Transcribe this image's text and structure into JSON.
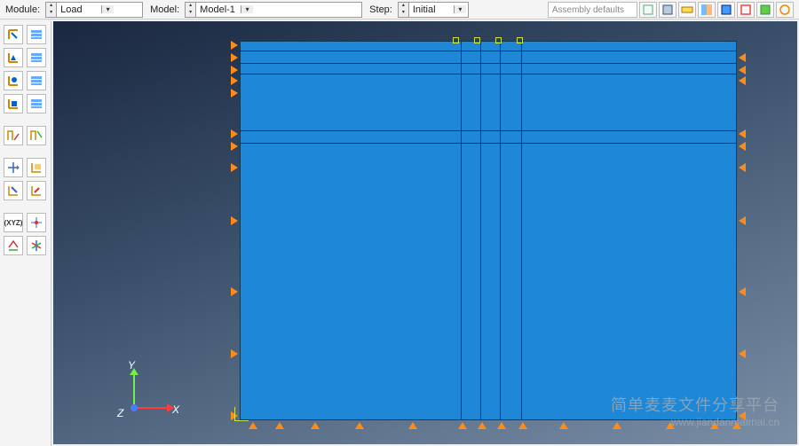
{
  "context_bar": {
    "module_label": "Module:",
    "module_value": "Load",
    "model_label": "Model:",
    "model_value": "Model-1",
    "step_label": "Step:",
    "step_value": "Initial"
  },
  "top_right": {
    "assembly_combo": "Assembly defaults"
  },
  "triad": {
    "x": "X",
    "y": "Y",
    "z": "Z"
  },
  "watermark": {
    "line1": "简单麦麦文件分享平台",
    "line2": "www.jiandanmaimai.cn"
  },
  "colors": {
    "model_fill": "#1e87d6",
    "bc_arrow": "#ff8c1a",
    "highlight": "#cde34a"
  },
  "side_tools": [
    {
      "row": [
        "create-load",
        "load-manager"
      ]
    },
    {
      "row": [
        "create-bc",
        "bc-manager"
      ]
    },
    {
      "row": [
        "create-predefined",
        "predefined-manager"
      ]
    },
    {
      "row": [
        "create-loadcase",
        "loadcase-manager"
      ]
    },
    {
      "sep": true
    },
    {
      "row": [
        "amplitude-1",
        "amplitude-2"
      ]
    },
    {
      "sep": true
    },
    {
      "row": [
        "translate-tool",
        "rotate-tool"
      ]
    },
    {
      "row": [
        "mirror-tool",
        "pattern-tool"
      ]
    },
    {
      "sep": true
    },
    {
      "row": [
        "xyz-csys",
        "pick-csys"
      ]
    },
    {
      "row": [
        "datum-tool",
        "partition-tool"
      ]
    }
  ],
  "top_right_icons": [
    "view-icon-1",
    "view-icon-2",
    "view-icon-3",
    "view-icon-4",
    "view-icon-5",
    "view-icon-6",
    "view-icon-7",
    "view-icon-8"
  ]
}
